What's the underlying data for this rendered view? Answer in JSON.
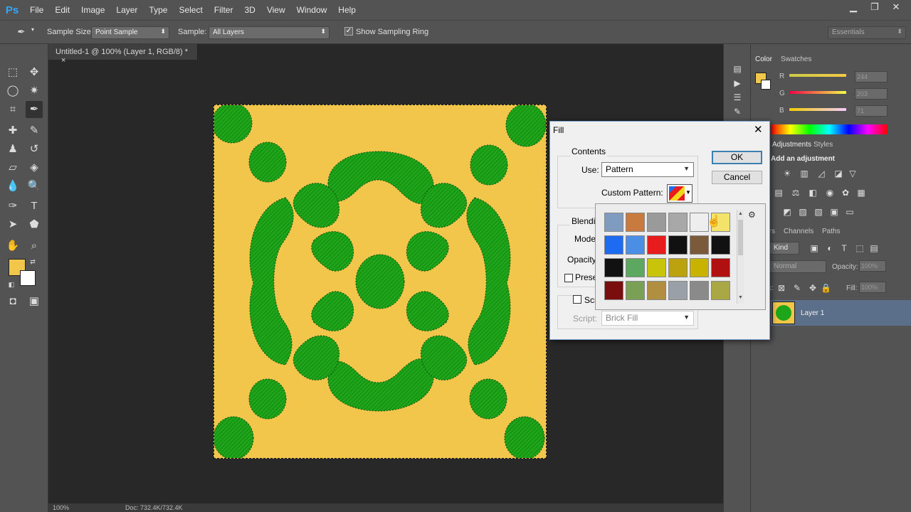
{
  "app": {
    "logo": "Ps"
  },
  "menu": [
    "File",
    "Edit",
    "Image",
    "Layer",
    "Type",
    "Select",
    "Filter",
    "3D",
    "View",
    "Window",
    "Help"
  ],
  "window_controls": {
    "minimize": "▁",
    "restore": "❐",
    "close": "✕"
  },
  "options": {
    "sample_size_label": "Sample Size:",
    "sample_size_value": "Point Sample",
    "sample_label": "Sample:",
    "sample_value": "All Layers",
    "show_ring_label": "Show Sampling Ring",
    "show_ring_checked": true,
    "workspace": "Essentials"
  },
  "document": {
    "tab_title": "Untitled-1 @ 100% (Layer 1, RGB/8) *",
    "tab_close": "×",
    "zoom": "100%",
    "doc_info": "Doc: 732.4K/732.4K",
    "pattern": {
      "background": "#f2c64a",
      "motif": "#1fa51a"
    }
  },
  "colors": {
    "foreground": "#f2c64a",
    "background": "#ffffff"
  },
  "color_panel": {
    "tabs": [
      "Color",
      "Swatches"
    ],
    "channels": [
      {
        "name": "R",
        "value": "244"
      },
      {
        "name": "G",
        "value": "203"
      },
      {
        "name": "B",
        "value": "71"
      }
    ]
  },
  "adjustments_panel": {
    "tabs": [
      "Adjustments",
      "Styles"
    ],
    "heading": "Add an adjustment"
  },
  "layers_panel": {
    "tabs": [
      "Layers",
      "Channels",
      "Paths"
    ],
    "kind": "Kind",
    "mode": "Normal",
    "opacity_label": "Opacity:",
    "opacity_value": "100%",
    "lock_label": "Lock:",
    "fill_label": "Fill:",
    "fill_value": "100%",
    "layer_name": "Layer 1"
  },
  "fill_dialog": {
    "title": "Fill",
    "close": "✕",
    "contents_label": "Contents",
    "use_label": "Use:",
    "use_value": "Pattern",
    "custom_pattern_label": "Custom Pattern:",
    "blending_label": "Blendi",
    "mode_label": "Mode",
    "opacity_label": "Opacity",
    "preserve_label": "Prese",
    "script_check_label": "Scr",
    "script_label": "Script:",
    "script_value": "Brick Fill",
    "ok": "OK",
    "cancel": "Cancel"
  },
  "pattern_picker": {
    "menu_icon": "gear-icon",
    "rows": [
      [
        "#7f9bc0",
        "#c97a3f",
        "#9a9a9a",
        "#a8a8a8",
        "#eeeeee",
        "#f3e36a"
      ],
      [
        "#1d6bf0",
        "#4a8ee6",
        "#e81c1c",
        "#111111",
        "#7a5a3a",
        "#111111"
      ],
      [
        "#111111",
        "#5ca860",
        "#c7c40a",
        "#bba20e",
        "#c8b300",
        "#b01010"
      ],
      [
        "#7a0e0e",
        "#7aa055",
        "#b09040",
        "#9aa0a8",
        "#8a8a8a",
        "#aaa845"
      ]
    ]
  }
}
